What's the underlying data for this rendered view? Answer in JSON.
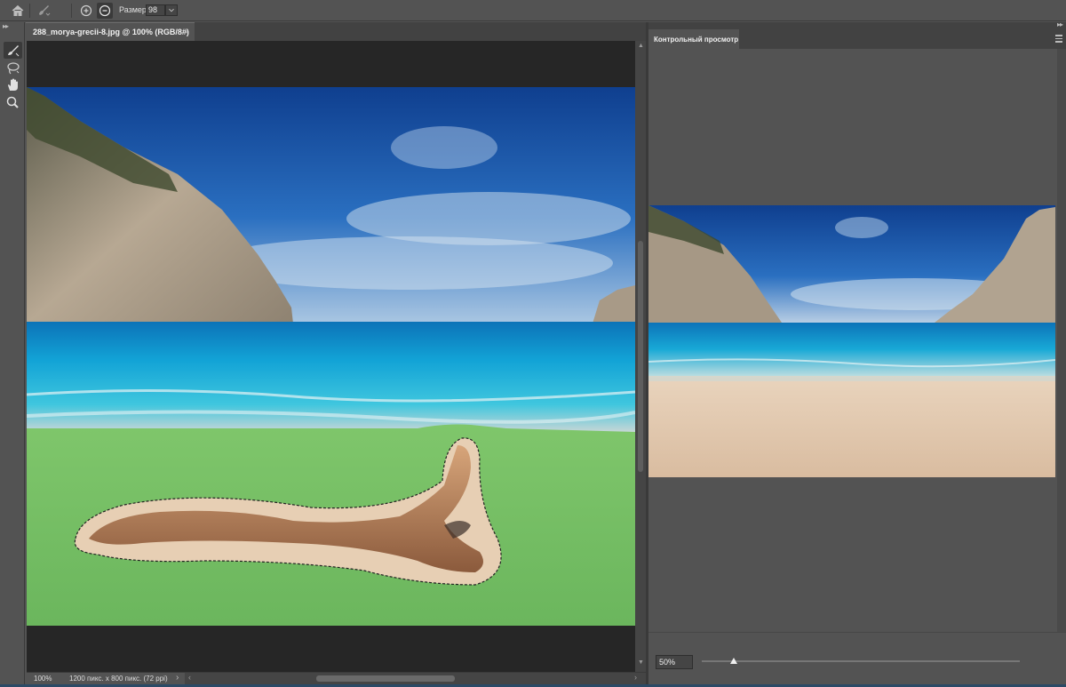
{
  "options_bar": {
    "size_label": "Размер:",
    "size_value": "98"
  },
  "document": {
    "tab_title": "288_morya-grecii-8.jpg @ 100% (RGB/8#)",
    "close_glyph": "×",
    "status_zoom": "100%",
    "status_size": "1200 пикс. x 800 пикс. (72 ppi)"
  },
  "preview_panel": {
    "tab_title": "Контрольный просмотр",
    "zoom_value": "50%",
    "zoom_slider_percent": 10
  },
  "icons": [
    "home-icon",
    "tool-preset-icon",
    "add-zoom-icon",
    "subtract-zoom-icon",
    "brush-tool-icon",
    "lasso-tool-icon",
    "hand-tool-icon",
    "zoom-tool-icon",
    "panel-menu-icon"
  ],
  "colors": {
    "ui_bg": "#535353",
    "canvas_bg": "#262626",
    "mask_overlay": "#7fc66b",
    "sky": "#1d5fb0",
    "sea": "#18a9d6"
  }
}
